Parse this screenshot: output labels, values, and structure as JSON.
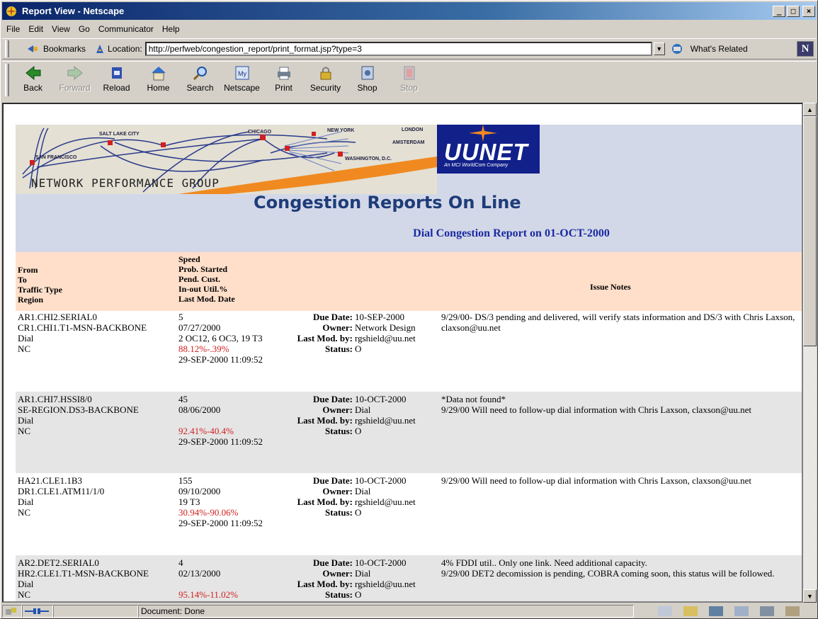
{
  "window": {
    "title": "Report View - Netscape"
  },
  "menu": [
    "File",
    "Edit",
    "View",
    "Go",
    "Communicator",
    "Help"
  ],
  "location_bar": {
    "bookmarks_label": "Bookmarks",
    "location_label": "Location:",
    "url": "http://perfweb/congestion_report/print_format.jsp?type=3",
    "whats_related_label": "What's Related",
    "brand_letter": "N"
  },
  "toolbar": [
    {
      "label": "Back",
      "icon": "back-arrow-icon",
      "enabled": true
    },
    {
      "label": "Forward",
      "icon": "forward-arrow-icon",
      "enabled": false
    },
    {
      "label": "Reload",
      "icon": "reload-icon",
      "enabled": true
    },
    {
      "label": "Home",
      "icon": "home-icon",
      "enabled": true
    },
    {
      "label": "Search",
      "icon": "search-icon",
      "enabled": true
    },
    {
      "label": "Netscape",
      "icon": "netscape-icon",
      "enabled": true
    },
    {
      "label": "Print",
      "icon": "printer-icon",
      "enabled": true
    },
    {
      "label": "Security",
      "icon": "lock-icon",
      "enabled": true
    },
    {
      "label": "Shop",
      "icon": "shop-icon",
      "enabled": true
    },
    {
      "label": "Stop",
      "icon": "stop-icon",
      "enabled": false
    }
  ],
  "page": {
    "banner_cities": [
      "SALT LAKE CITY",
      "SAN FRANCISCO",
      "CHICAGO",
      "NEW YORK",
      "LONDON",
      "AMSTERDAM",
      "WASHINGTON, D.C."
    ],
    "brand": {
      "name": "UUNET",
      "tagline": "An MCI WorldCom Company"
    },
    "group": "NETWORK PERFORMANCE GROUP",
    "title": "Congestion Reports On Line",
    "subtitle": "Dial Congestion Report on 01-OCT-2000",
    "headers": {
      "col1": [
        "From",
        "To",
        "Traffic Type",
        "Region"
      ],
      "col2": [
        "Speed",
        "Prob. Started",
        "Pend. Cust.",
        "In-out Util.%",
        "Last Mod. Date"
      ],
      "col4": "Issue Notes"
    },
    "field_labels": {
      "due_date": "Due Date:",
      "owner": "Owner:",
      "last_mod_by": "Last Mod. by:",
      "status": "Status:"
    },
    "rows": [
      {
        "from": "AR1.CHI2.SERIAL0",
        "to": "CR1.CHI1.T1-MSN-BACKBONE",
        "traffic": "Dial",
        "region": "NC",
        "speed": "5",
        "started": "07/27/2000",
        "pend": "2 OC12, 6 OC3, 19 T3",
        "util": "88.12%-.39%",
        "lastmod": "29-SEP-2000 11:09:52",
        "due": "10-SEP-2000",
        "owner": "Network Design",
        "by": "rgshield@uu.net",
        "status": "O",
        "notes": "9/29/00- DS/3 pending and delivered, will verify stats information and DS/3 with Chris Laxson, claxson@uu.net"
      },
      {
        "from": "AR1.CHI7.HSSI8/0",
        "to": "SE-REGION.DS3-BACKBONE",
        "traffic": "Dial",
        "region": "NC",
        "speed": "45",
        "started": "08/06/2000",
        "pend": "",
        "util": "92.41%-40.4%",
        "lastmod": "29-SEP-2000 11:09:52",
        "due": "10-OCT-2000",
        "owner": "Dial",
        "by": "rgshield@uu.net",
        "status": "O",
        "notes": "*Data not found*\n9/29/00 Will need to follow-up dial information with Chris Laxson, claxson@uu.net"
      },
      {
        "from": "HA21.CLE1.1B3",
        "to": "DR1.CLE1.ATM11/1/0",
        "traffic": "Dial",
        "region": "NC",
        "speed": "155",
        "started": "09/10/2000",
        "pend": "19 T3",
        "util": "30.94%-90.06%",
        "lastmod": "29-SEP-2000 11:09:52",
        "due": "10-OCT-2000",
        "owner": "Dial",
        "by": "rgshield@uu.net",
        "status": "O",
        "notes": "9/29/00 Will need to follow-up dial information with Chris Laxson, claxson@uu.net"
      },
      {
        "from": "AR2.DET2.SERIAL0",
        "to": "HR2.CLE1.T1-MSN-BACKBONE",
        "traffic": "Dial",
        "region": "NC",
        "speed": "4",
        "started": "02/13/2000",
        "pend": "",
        "util": "95.14%-11.02%",
        "lastmod": "",
        "due": "10-OCT-2000",
        "owner": "Dial",
        "by": "rgshield@uu.net",
        "status": "O",
        "notes": "4% FDDI util.. Only one link. Need additional capacity.\n9/29/00 DET2 decomission is pending, COBRA coming soon, this status will be followed."
      }
    ]
  },
  "statusbar": {
    "text": "Document: Done"
  }
}
